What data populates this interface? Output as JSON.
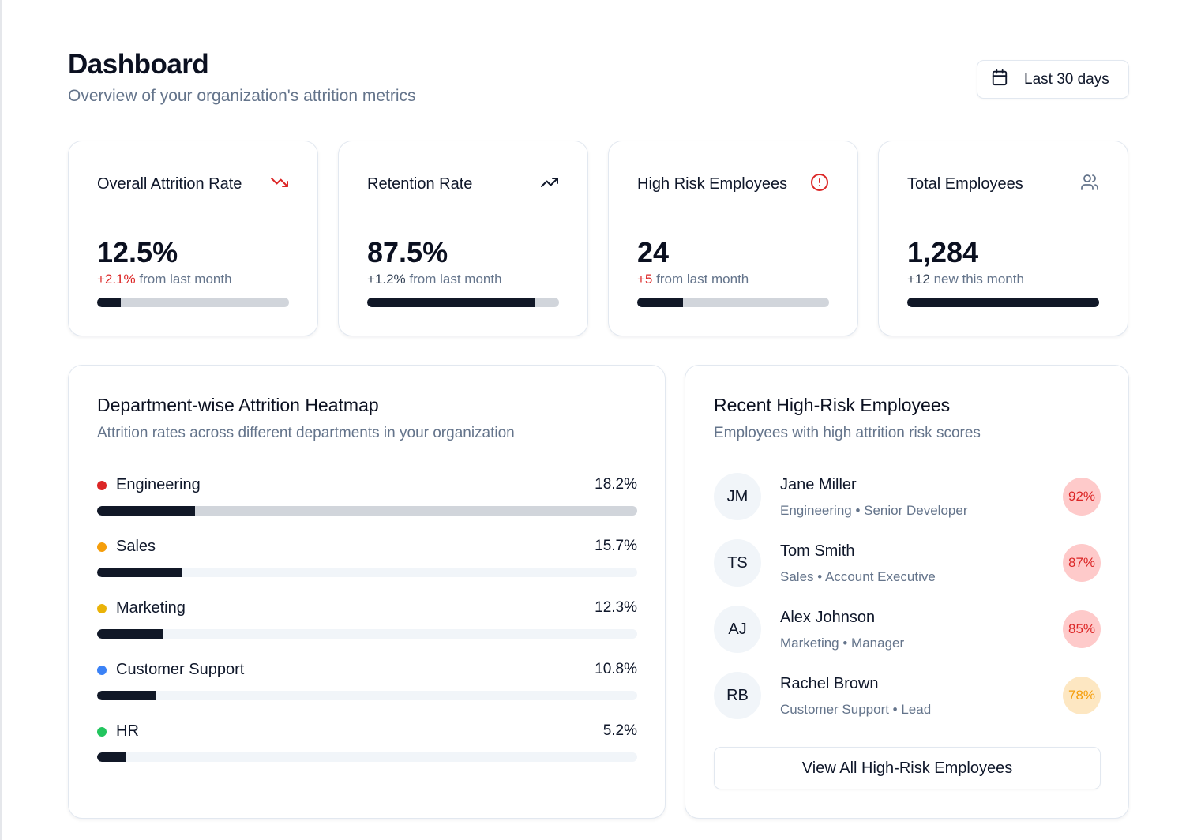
{
  "header": {
    "title": "Dashboard",
    "subtitle": "Overview of your organization's attrition metrics",
    "date_range_label": "Last 30 days"
  },
  "stats": [
    {
      "title": "Overall Attrition Rate",
      "icon": "trending-down-icon",
      "value": "12.5%",
      "change": "+2.1%",
      "change_suffix": " from last month",
      "progress": 0.125,
      "change_color": "#dc2626"
    },
    {
      "title": "Retention Rate",
      "icon": "trending-up-icon",
      "value": "87.5%",
      "change": "+1.2%",
      "change_suffix": " from last month",
      "progress": 0.875,
      "change_color": "#334155"
    },
    {
      "title": "High Risk Employees",
      "icon": "alert-circle-icon",
      "value": "24",
      "change": "+5",
      "change_suffix": " from last month",
      "progress": 0.24,
      "change_color": "#dc2626"
    },
    {
      "title": "Total Employees",
      "icon": "users-icon",
      "value": "1,284",
      "change": "+12",
      "change_suffix": " new this month",
      "progress": 1.0,
      "change_color": "#334155"
    }
  ],
  "heatmap": {
    "title": "Department-wise Attrition Heatmap",
    "subtitle": "Attrition rates across different departments in your organization",
    "departments": [
      {
        "name": "Engineering",
        "value": "18.2%",
        "progress": 0.182,
        "dot_color": "#dc2626"
      },
      {
        "name": "Sales",
        "value": "15.7%",
        "progress": 0.157,
        "dot_color": "#f59e0b"
      },
      {
        "name": "Marketing",
        "value": "12.3%",
        "progress": 0.123,
        "dot_color": "#eab308"
      },
      {
        "name": "Customer Support",
        "value": "10.8%",
        "progress": 0.108,
        "dot_color": "#3b82f6"
      },
      {
        "name": "HR",
        "value": "5.2%",
        "progress": 0.052,
        "dot_color": "#22c55e"
      }
    ]
  },
  "high_risk": {
    "title": "Recent High-Risk Employees",
    "subtitle": "Employees with high attrition risk scores",
    "employees": [
      {
        "initials": "JM",
        "name": "Jane Miller",
        "meta": "Engineering • Senior Developer",
        "risk": "92%",
        "level": "high"
      },
      {
        "initials": "TS",
        "name": "Tom Smith",
        "meta": "Sales • Account Executive",
        "risk": "87%",
        "level": "high"
      },
      {
        "initials": "AJ",
        "name": "Alex Johnson",
        "meta": "Marketing • Manager",
        "risk": "85%",
        "level": "high"
      },
      {
        "initials": "RB",
        "name": "Rachel Brown",
        "meta": "Customer Support • Lead",
        "risk": "78%",
        "level": "med"
      }
    ],
    "view_all_label": "View All High-Risk Employees"
  }
}
